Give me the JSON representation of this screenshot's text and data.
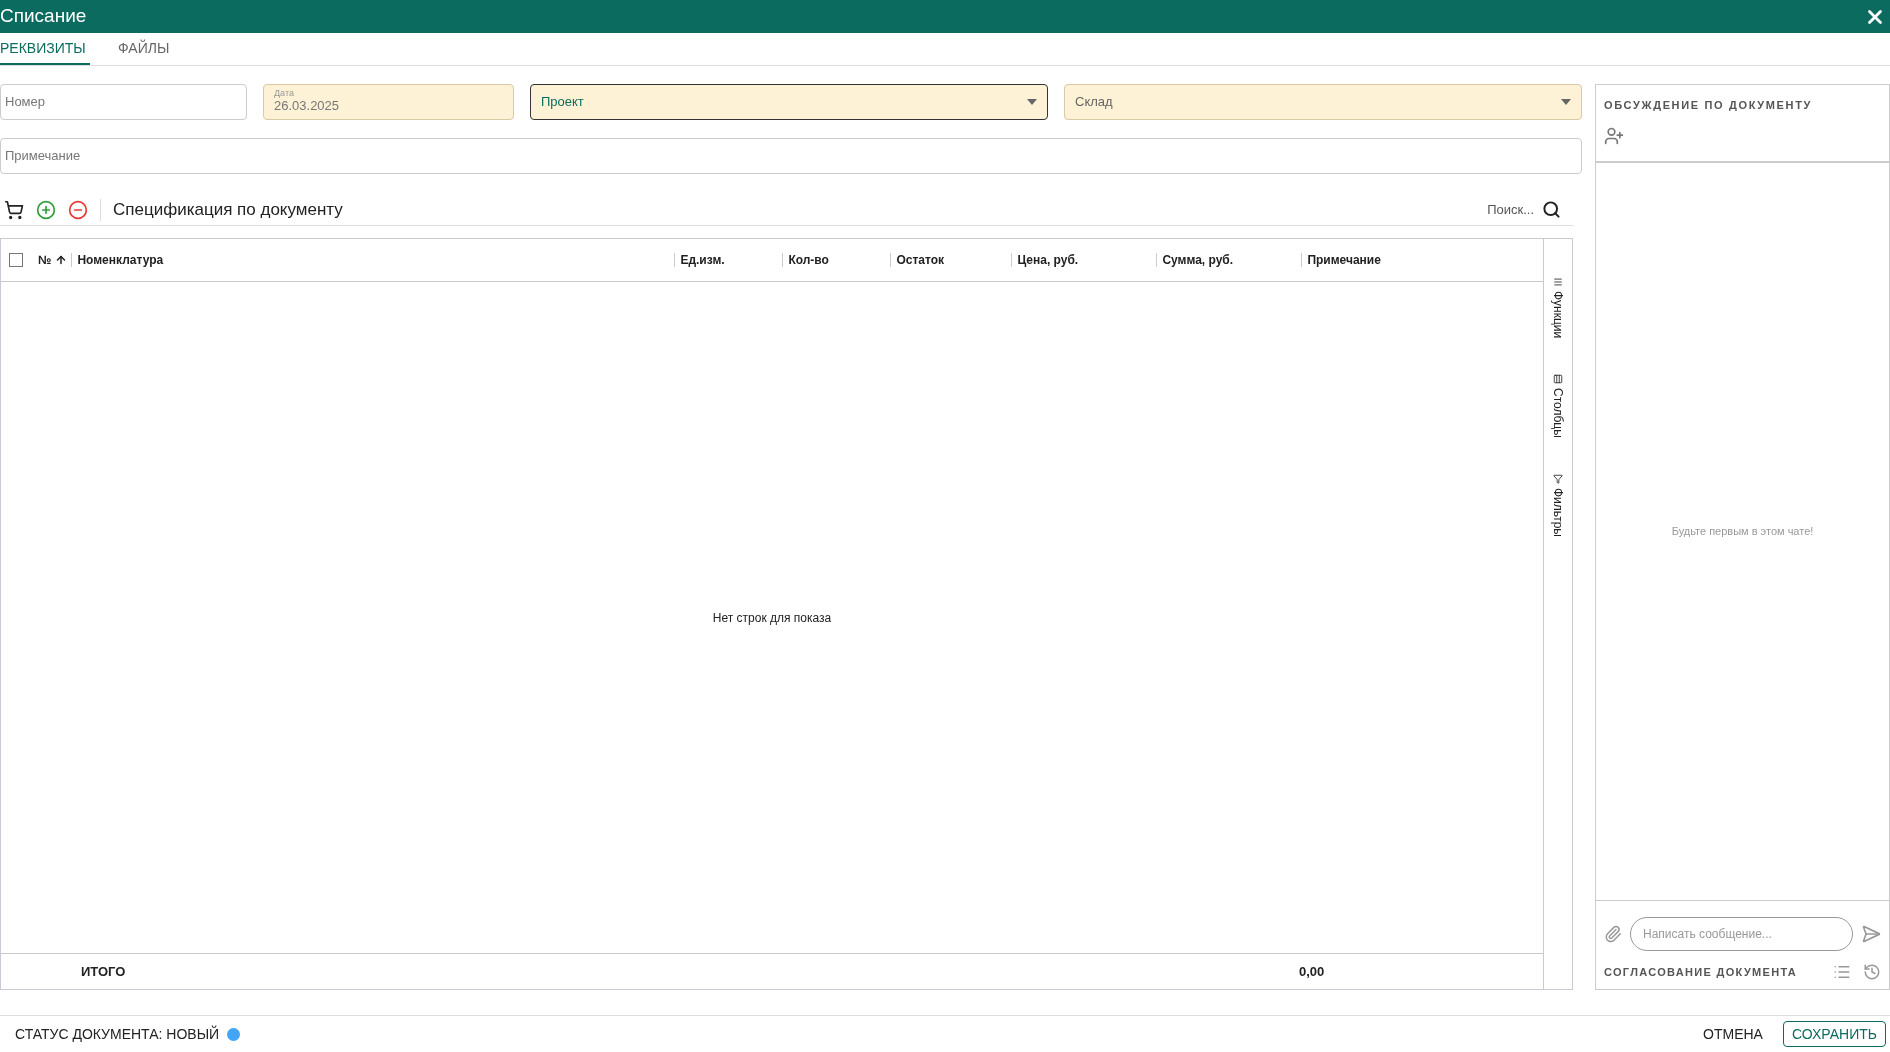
{
  "window": {
    "title": "Списание"
  },
  "tabs": [
    {
      "label": "РЕКВИЗИТЫ",
      "selected": true
    },
    {
      "label": "ФАЙЛЫ",
      "selected": false
    }
  ],
  "fields": {
    "number": {
      "placeholder": "Номер"
    },
    "date": {
      "label": "Дата",
      "value": "26.03.2025"
    },
    "project": {
      "placeholder": "Проект"
    },
    "warehouse": {
      "placeholder": "Склад"
    },
    "note": {
      "placeholder": "Примечание"
    }
  },
  "spec": {
    "title": "Спецификация по документу",
    "search": {
      "placeholder": "Поиск..."
    },
    "columns": [
      "№",
      "Ед.изм.",
      "Кол-во",
      "Остаток",
      "Цена, руб.",
      "Сумма, руб.",
      "Примечание"
    ],
    "name_column": "Номенклатура",
    "select_all": {
      "checked": false
    },
    "empty": "Нет строк для показа",
    "total": {
      "label": "ИТОГО",
      "sum": "0,00"
    },
    "side_tabs": [
      {
        "kind": "functions",
        "label": "Функции"
      },
      {
        "kind": "columns",
        "label": "Столбцы"
      },
      {
        "kind": "filters",
        "label": "Фильтры"
      }
    ]
  },
  "discussion": {
    "title": "ОБСУЖДЕНИЕ ПО ДОКУМЕНТУ",
    "empty": "Будьте первым в этом чате!",
    "message": {
      "placeholder": "Написать сообщение..."
    },
    "approval": "СОГЛАСОВАНИЕ ДОКУМЕНТА"
  },
  "status": {
    "text": "СТАТУС ДОКУМЕНТА: НОВЫЙ",
    "color": "#42a5f5"
  },
  "buttons": {
    "cancel": "ОТМЕНА",
    "save": "СОХРАНИТЬ"
  }
}
